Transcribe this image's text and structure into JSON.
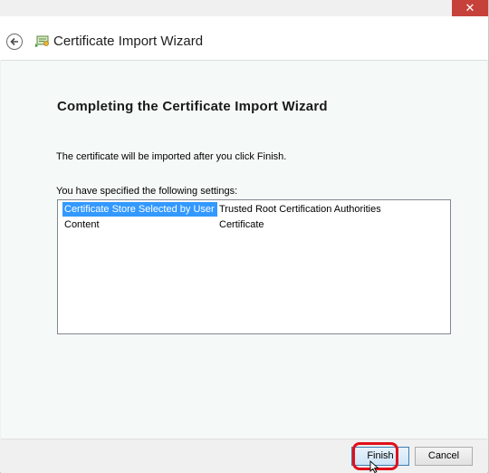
{
  "window": {
    "title": "Certificate Import Wizard",
    "close_label": "✕"
  },
  "page": {
    "heading": "Completing the Certificate Import Wizard",
    "description": "The certificate will be imported after you click Finish.",
    "settings_label": "You have specified the following settings:"
  },
  "settings": [
    {
      "key": "Certificate Store Selected by User",
      "value": "Trusted Root Certification Authorities",
      "selected": true
    },
    {
      "key": "Content",
      "value": "Certificate",
      "selected": false
    }
  ],
  "buttons": {
    "finish": "Finish",
    "cancel": "Cancel"
  },
  "colors": {
    "close_button": "#c7413b",
    "selection": "#3399ff",
    "highlight_box": "#e0101b"
  },
  "icons": [
    "back-arrow-icon",
    "certificate-wizard-icon",
    "close-icon",
    "mouse-cursor-icon"
  ]
}
